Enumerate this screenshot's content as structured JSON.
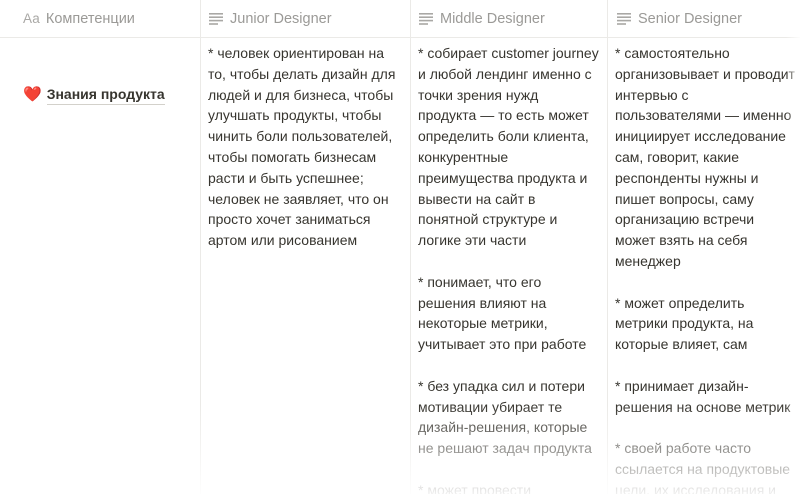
{
  "columns": {
    "name": {
      "label": "Компетенции",
      "icon": "title-property-icon"
    },
    "junior": {
      "label": "Junior Designer",
      "icon": "text-property-icon"
    },
    "middle": {
      "label": "Middle Designer",
      "icon": "text-property-icon"
    },
    "senior": {
      "label": "Senior Designer",
      "icon": "text-property-icon"
    }
  },
  "aa_label": "Aa",
  "row": {
    "emoji": "❤️",
    "title": "Знания продукта",
    "junior": "* человек ориентирован на то, чтобы делать дизайн для людей и для бизнеса, чтобы улучшать продукты, чтобы чинить боли пользователей, чтобы помогать бизнесам расти и быть успешнее; человек не заявляет, что он просто хочет заниматься артом или рисованием",
    "middle": "* собирает customer journey и любой лендинг именно с точки зрения нужд продукта — то есть может определить боли клиента, конкурентные преимущества продукта и вывести на сайт в понятной структуре и логике эти части\n\n* понимает, что его решения влияют на некоторые метрики, учитывает это при работе\n\n* без упадка сил и потери мотивации убирает те дизайн-решения, которые не решают задач продукта\n\n* может провести",
    "senior": "* самостоятельно организовывает и проводит интервью с пользователями — именно инициирует исследование сам, говорит, какие респонденты нужны и пишет вопросы, саму организацию встречи может взять на себя менеджер\n\n* может определить метрики продукта, на которые влияет, сам\n\n* принимает дизайн-решения на основе метрик\n\n* своей работе часто ссылается на продуктовые цели, их исследования и"
  }
}
